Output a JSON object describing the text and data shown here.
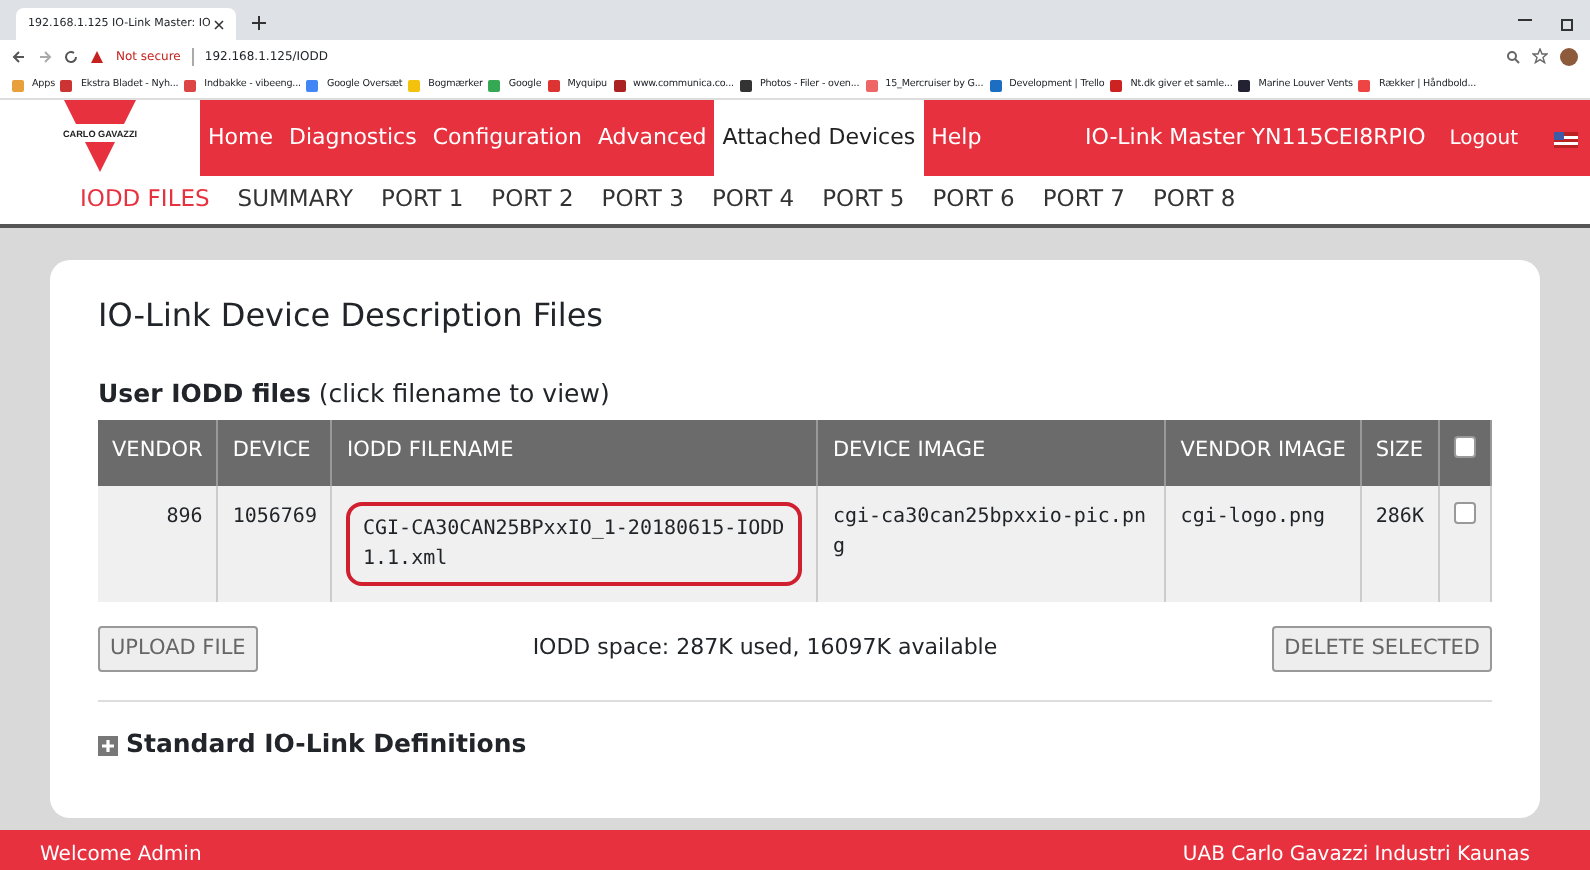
{
  "browser": {
    "tab_title": "192.168.1.125 IO-Link Master: IO",
    "security": "Not secure",
    "url": "192.168.1.125/IODD",
    "bookmarks": [
      "Apps",
      "Ekstra Bladet - Nyh...",
      "Indbakke - vibeeng...",
      "Google Oversæt",
      "Bogmærker",
      "Google",
      "Myquipu",
      "www.communica.co...",
      "Photos - Filer - oven...",
      "15_Mercruiser by G...",
      "Development | Trello",
      "Nt.dk giver et samle...",
      "Marine Louver Vents",
      "Rækker | Håndbold..."
    ]
  },
  "logo": "CARLO GAVAZZI",
  "nav": [
    {
      "label": "Home",
      "selected": false
    },
    {
      "label": "Diagnostics",
      "selected": false
    },
    {
      "label": "Configuration",
      "selected": false
    },
    {
      "label": "Advanced",
      "selected": false
    },
    {
      "label": "Attached Devices",
      "selected": true
    },
    {
      "label": "Help",
      "selected": false
    }
  ],
  "device_name": "IO-Link Master YN115CEI8RPIO",
  "logout": "Logout",
  "subnav": [
    {
      "label": "IODD FILES",
      "selected": true
    },
    {
      "label": "SUMMARY",
      "selected": false
    },
    {
      "label": "PORT 1",
      "selected": false
    },
    {
      "label": "PORT 2",
      "selected": false
    },
    {
      "label": "PORT 3",
      "selected": false
    },
    {
      "label": "PORT 4",
      "selected": false
    },
    {
      "label": "PORT 5",
      "selected": false
    },
    {
      "label": "PORT 6",
      "selected": false
    },
    {
      "label": "PORT 7",
      "selected": false
    },
    {
      "label": "PORT 8",
      "selected": false
    }
  ],
  "page_title": "IO-Link Device Description Files",
  "section": "**User IODD files** (click filename to view)",
  "table": {
    "columns": [
      "VENDOR",
      "DEVICE",
      "IODD FILENAME",
      "DEVICE IMAGE",
      "VENDOR IMAGE",
      "SIZE"
    ],
    "select_all_checked": false,
    "rows": [
      {
        "cells": [
          "896",
          "1056769",
          "CGI-CA30CAN25BPxxIO_1-20180615-IODD1.1.xml",
          "cgi-ca30can25bpxxio-pic.png",
          "cgi-logo.png",
          "286K"
        ],
        "checked": false,
        "highlighted": true
      }
    ]
  },
  "upload_button": "UPLOAD FILE",
  "space_info": "IODD space: 287K used, 16097K available",
  "delete_button": "DELETE SELECTED",
  "standard_section": {
    "label": "Standard IO-Link Definitions",
    "expanded": false
  },
  "footer": {
    "left": "Welcome Admin",
    "right": "UAB Carlo Gavazzi Industri Kaunas"
  }
}
